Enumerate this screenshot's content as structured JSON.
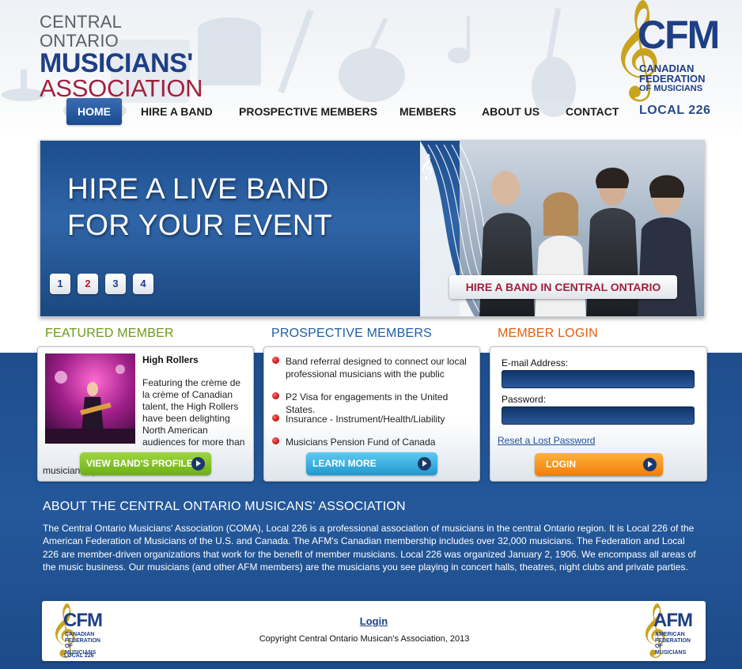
{
  "header": {
    "coma_logo": {
      "line1": "CENTRAL ONTARIO",
      "line2": "MUSICIANS'",
      "line3": "ASSOCIATION"
    },
    "cfm_logo": {
      "mark": "CFM",
      "sub1": "CANADIAN",
      "sub2": "FEDERATION",
      "sub3": "OF MUSICIANS"
    },
    "local": "LOCAL 226"
  },
  "nav": {
    "items": [
      {
        "label": "HOME",
        "active": true
      },
      {
        "label": "HIRE A BAND"
      },
      {
        "label": "PROSPECTIVE MEMBERS"
      },
      {
        "label": "MEMBERS"
      },
      {
        "label": "ABOUT US"
      },
      {
        "label": "CONTACT"
      }
    ]
  },
  "hero": {
    "line1": "HIRE A LIVE BAND",
    "line2": "FOR YOUR EVENT",
    "slides": [
      "1",
      "2",
      "3",
      "4"
    ],
    "active_slide": "2",
    "cta": "HIRE A BAND IN CENTRAL ONTARIO"
  },
  "featured": {
    "title": "FEATURED MEMBER",
    "name": "High Rollers",
    "desc": "Featuring the crème de la crème of Canadian talent, the High Rollers have been delighting North American audiences for more than two decades with their high octane live",
    "tail": "musicianship.",
    "button": "VIEW BAND'S PROFILE"
  },
  "prospective": {
    "title": "PROSPECTIVE MEMBERS",
    "bullets": [
      "Band referral designed to connect our local professional musicians with the public",
      "P2 Visa for engagements in the United States.",
      "Insurance - Instrument/Health/Liability",
      "Musicians Pension Fund of Canada"
    ],
    "button": "LEARN MORE"
  },
  "login": {
    "title": "MEMBER LOGIN",
    "email_label": "E-mail Address:",
    "email_value": "",
    "password_label": "Password:",
    "password_value": "",
    "reset": "Reset a Lost Password",
    "button": "LOGIN"
  },
  "about": {
    "title": "ABOUT THE CENTRAL ONTARIO MUSICANS' ASSOCIATION",
    "text": "The Central Ontario Musicians' Association (COMA), Local 226 is a professional association of musicians in the central Ontario region. It is Local 226 of the American Federation of Musicians of the U.S. and Canada. The AFM's Canadian membership includes over 32,000 musicians. The Federation and Local 226 are member-driven organizations that work for the benefit of member musicians. Local 226 was organized January 2, 1906. We encompass all areas of the music business. Our musicians (and other AFM members) are the musicians you see playing in concert halls, theatres, night clubs and private parties."
  },
  "footer": {
    "login": "Login",
    "copyright": "Copyright Central Ontario Musican's Association, 2013",
    "left_logo": {
      "mark": "CFM",
      "sub": "CANADIAN FEDERATION OF MUSICIANS",
      "local": "LOCAL 226"
    },
    "right_logo": {
      "mark": "AFM",
      "sub": "AMERICAN FEDERATION OF MUSICIANS"
    }
  },
  "colors": {
    "navy": "#1e3f86",
    "burgundy": "#a3203d",
    "gold": "#c9a31d",
    "green": "#6eae17",
    "orange": "#f07c0a",
    "cyan": "#1f98cf"
  }
}
